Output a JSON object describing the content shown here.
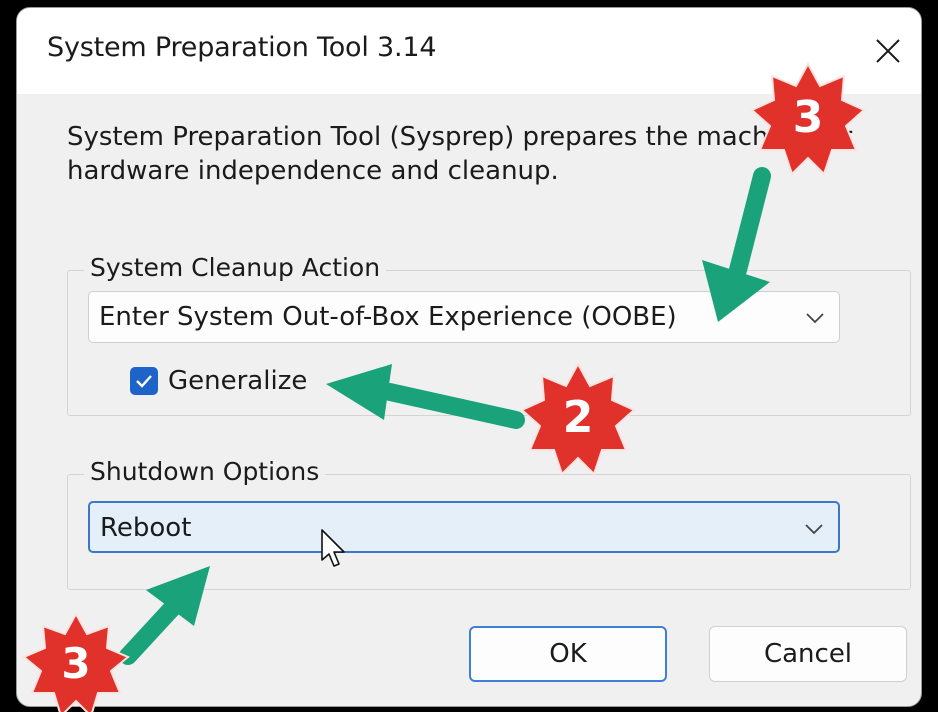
{
  "window": {
    "title": "System Preparation Tool 3.14",
    "description": "System Preparation Tool (Sysprep) prepares the machine for hardware independence and cleanup."
  },
  "cleanup": {
    "legend": "System Cleanup Action",
    "selected": "Enter System Out-of-Box Experience (OOBE)",
    "generalize_label": "Generalize",
    "generalize_checked": true
  },
  "shutdown": {
    "legend": "Shutdown Options",
    "selected": "Reboot"
  },
  "buttons": {
    "ok": "OK",
    "cancel": "Cancel"
  },
  "annotations": {
    "badge_top": "3",
    "badge_middle": "2",
    "badge_bottom": "3"
  },
  "colors": {
    "accent": "#1e63c7",
    "arrow": "#1aa37a",
    "badge": "#e0312b"
  }
}
